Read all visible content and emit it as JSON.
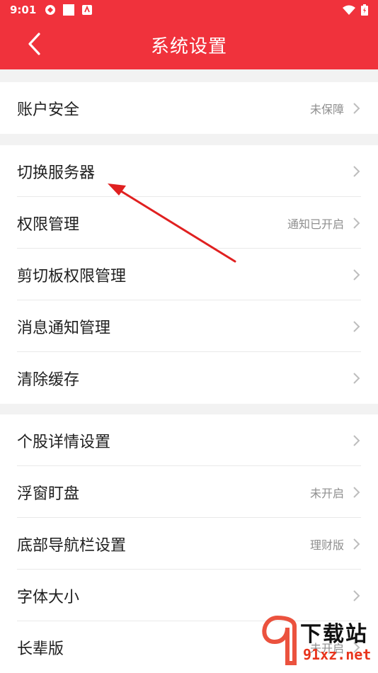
{
  "status_bar": {
    "time": "9:01"
  },
  "header": {
    "title": "系统设置"
  },
  "groups": [
    {
      "items": [
        {
          "label": "账户安全",
          "value": "未保障"
        }
      ]
    },
    {
      "items": [
        {
          "label": "切换服务器",
          "value": ""
        },
        {
          "label": "权限管理",
          "value": "通知已开启"
        },
        {
          "label": "剪切板权限管理",
          "value": ""
        },
        {
          "label": "消息通知管理",
          "value": ""
        },
        {
          "label": "清除缓存",
          "value": ""
        }
      ]
    },
    {
      "items": [
        {
          "label": "个股详情设置",
          "value": ""
        },
        {
          "label": "浮窗盯盘",
          "value": "未开启"
        },
        {
          "label": "底部导航栏设置",
          "value": "理财版"
        },
        {
          "label": "字体大小",
          "value": ""
        },
        {
          "label": "长辈版",
          "value": "未开启"
        }
      ]
    }
  ],
  "watermark": {
    "text": "下载站",
    "url": "91xz.net"
  },
  "colors": {
    "brand": "#f0323c",
    "annotation": "#e02020"
  }
}
